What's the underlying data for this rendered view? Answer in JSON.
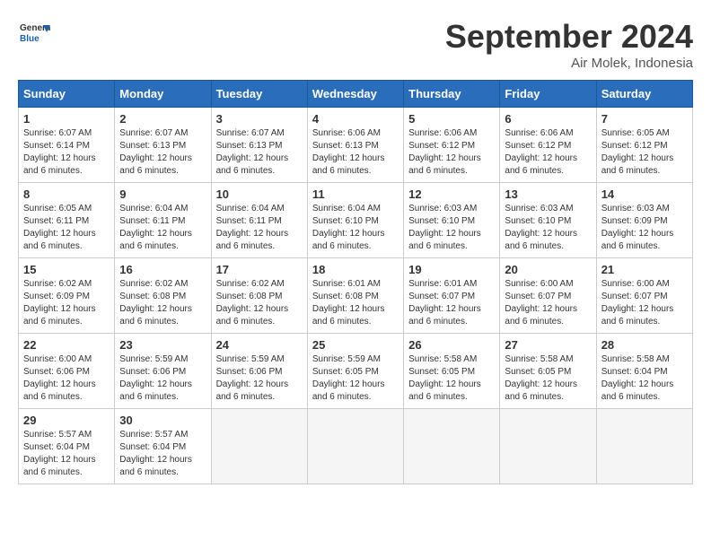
{
  "header": {
    "logo_general": "General",
    "logo_blue": "Blue",
    "title": "September 2024",
    "location": "Air Molek, Indonesia"
  },
  "days_of_week": [
    "Sunday",
    "Monday",
    "Tuesday",
    "Wednesday",
    "Thursday",
    "Friday",
    "Saturday"
  ],
  "weeks": [
    [
      {
        "day": "1",
        "sunrise": "6:07 AM",
        "sunset": "6:14 PM",
        "daylight": "12 hours and 6 minutes."
      },
      {
        "day": "2",
        "sunrise": "6:07 AM",
        "sunset": "6:13 PM",
        "daylight": "12 hours and 6 minutes."
      },
      {
        "day": "3",
        "sunrise": "6:07 AM",
        "sunset": "6:13 PM",
        "daylight": "12 hours and 6 minutes."
      },
      {
        "day": "4",
        "sunrise": "6:06 AM",
        "sunset": "6:13 PM",
        "daylight": "12 hours and 6 minutes."
      },
      {
        "day": "5",
        "sunrise": "6:06 AM",
        "sunset": "6:12 PM",
        "daylight": "12 hours and 6 minutes."
      },
      {
        "day": "6",
        "sunrise": "6:06 AM",
        "sunset": "6:12 PM",
        "daylight": "12 hours and 6 minutes."
      },
      {
        "day": "7",
        "sunrise": "6:05 AM",
        "sunset": "6:12 PM",
        "daylight": "12 hours and 6 minutes."
      }
    ],
    [
      {
        "day": "8",
        "sunrise": "6:05 AM",
        "sunset": "6:11 PM",
        "daylight": "12 hours and 6 minutes."
      },
      {
        "day": "9",
        "sunrise": "6:04 AM",
        "sunset": "6:11 PM",
        "daylight": "12 hours and 6 minutes."
      },
      {
        "day": "10",
        "sunrise": "6:04 AM",
        "sunset": "6:11 PM",
        "daylight": "12 hours and 6 minutes."
      },
      {
        "day": "11",
        "sunrise": "6:04 AM",
        "sunset": "6:10 PM",
        "daylight": "12 hours and 6 minutes."
      },
      {
        "day": "12",
        "sunrise": "6:03 AM",
        "sunset": "6:10 PM",
        "daylight": "12 hours and 6 minutes."
      },
      {
        "day": "13",
        "sunrise": "6:03 AM",
        "sunset": "6:10 PM",
        "daylight": "12 hours and 6 minutes."
      },
      {
        "day": "14",
        "sunrise": "6:03 AM",
        "sunset": "6:09 PM",
        "daylight": "12 hours and 6 minutes."
      }
    ],
    [
      {
        "day": "15",
        "sunrise": "6:02 AM",
        "sunset": "6:09 PM",
        "daylight": "12 hours and 6 minutes."
      },
      {
        "day": "16",
        "sunrise": "6:02 AM",
        "sunset": "6:08 PM",
        "daylight": "12 hours and 6 minutes."
      },
      {
        "day": "17",
        "sunrise": "6:02 AM",
        "sunset": "6:08 PM",
        "daylight": "12 hours and 6 minutes."
      },
      {
        "day": "18",
        "sunrise": "6:01 AM",
        "sunset": "6:08 PM",
        "daylight": "12 hours and 6 minutes."
      },
      {
        "day": "19",
        "sunrise": "6:01 AM",
        "sunset": "6:07 PM",
        "daylight": "12 hours and 6 minutes."
      },
      {
        "day": "20",
        "sunrise": "6:00 AM",
        "sunset": "6:07 PM",
        "daylight": "12 hours and 6 minutes."
      },
      {
        "day": "21",
        "sunrise": "6:00 AM",
        "sunset": "6:07 PM",
        "daylight": "12 hours and 6 minutes."
      }
    ],
    [
      {
        "day": "22",
        "sunrise": "6:00 AM",
        "sunset": "6:06 PM",
        "daylight": "12 hours and 6 minutes."
      },
      {
        "day": "23",
        "sunrise": "5:59 AM",
        "sunset": "6:06 PM",
        "daylight": "12 hours and 6 minutes."
      },
      {
        "day": "24",
        "sunrise": "5:59 AM",
        "sunset": "6:06 PM",
        "daylight": "12 hours and 6 minutes."
      },
      {
        "day": "25",
        "sunrise": "5:59 AM",
        "sunset": "6:05 PM",
        "daylight": "12 hours and 6 minutes."
      },
      {
        "day": "26",
        "sunrise": "5:58 AM",
        "sunset": "6:05 PM",
        "daylight": "12 hours and 6 minutes."
      },
      {
        "day": "27",
        "sunrise": "5:58 AM",
        "sunset": "6:05 PM",
        "daylight": "12 hours and 6 minutes."
      },
      {
        "day": "28",
        "sunrise": "5:58 AM",
        "sunset": "6:04 PM",
        "daylight": "12 hours and 6 minutes."
      }
    ],
    [
      {
        "day": "29",
        "sunrise": "5:57 AM",
        "sunset": "6:04 PM",
        "daylight": "12 hours and 6 minutes."
      },
      {
        "day": "30",
        "sunrise": "5:57 AM",
        "sunset": "6:04 PM",
        "daylight": "12 hours and 6 minutes."
      },
      null,
      null,
      null,
      null,
      null
    ]
  ]
}
